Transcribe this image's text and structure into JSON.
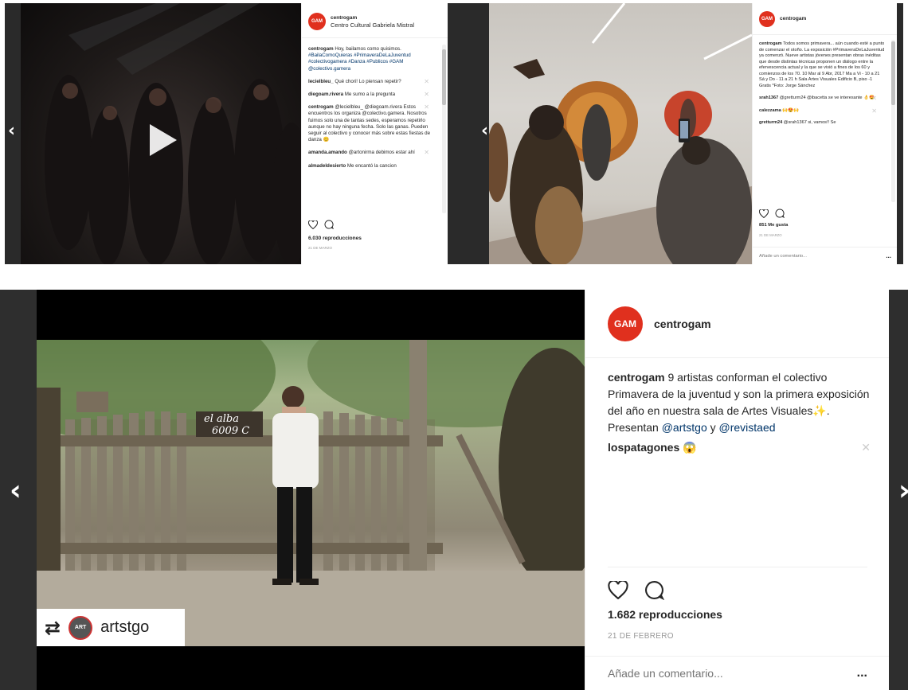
{
  "panel1": {
    "username": "centrogam",
    "location": "Centro Cultural Gabriela Mistral",
    "avatar_text": "GAM",
    "caption_user": "centrogam",
    "caption_text": "Hoy, bailamos como quisimos.",
    "caption_tags": "#BailaComoQuieras #PrimaveraDeLaJuventud #colectivogamera #Danza #Publicos #GAM @colectivo.gamera",
    "comments": [
      {
        "user": "lecielbleu_",
        "text": "Qué chori! Lo piensan repetir?"
      },
      {
        "user": "diegoam.rivera",
        "text": "Me sumo a la pregunta"
      },
      {
        "user": "centrogam",
        "text": "@lecielbleu_ @diegoam.rivera Estos encuentros los organiza @colectivo.gamera. Nosotros fuimos solo una de tantas sedes, esperamos repetirlo aunque no hay ninguna fecha. Solo las ganas. Pueden seguir al colectivo y conocer más sobre estas fiestas de danza 😊"
      },
      {
        "user": "amanda.amando",
        "text": "@artonirma debimos estar ahí"
      },
      {
        "user": "almadeldesierto",
        "text": "Me encantó la cancion"
      }
    ],
    "views": "6.030 reproducciones",
    "date": "21 DE MARZO"
  },
  "panel2": {
    "username": "centrogam",
    "avatar_text": "GAM",
    "caption_user": "centrogam",
    "caption_text": "Todos somos primavera... aún cuando esté a punto de comenzar el otoño. La exposición #PrimaveraDeLaJuventud ya comenzó. Nueve artistas jóvenes presentan obras inéditas que desde distintas técnicas proponen un diálogo entre la efervescencia actual y la que se vivió a fines de los 60 y comienzos de los 70. 10 Mar al 9 Abr, 2017 Ma a Vi - 10 a 21 Sá y Do - 11 a 21 h Sala Artes Visuales Edificio B, piso -1 Gratis *Foto: Jorge Sánchez",
    "comments": [
      {
        "user": "srah1367",
        "text": "@gretturm24 @ibacetta se ve interesante 👌😍"
      },
      {
        "user": "calezzama",
        "text": "🙌😍🙌"
      },
      {
        "user": "gretturm24",
        "text": "@srah1367 si, vamos!! Se"
      }
    ],
    "likes": "851 Me gusta",
    "date": "21 DE MARZO",
    "add_comment_placeholder": "Añade un comentario...",
    "more": "..."
  },
  "panel3": {
    "username": "centrogam",
    "avatar_text": "GAM",
    "caption_user": "centrogam",
    "caption_text": "9 artistas conforman el colectivo Primavera de la juventud y son la primera exposición del año en nuestra sala de Artes Visuales✨. Presentan",
    "mention1": "@artstgo",
    "caption_and": "y",
    "mention2": "@revistaed",
    "comment_user": "lospatagones",
    "comment_text": "😱",
    "sign_text1": "el alba",
    "sign_text2": "6009 C",
    "repost_user": "artstgo",
    "repost_avatar_text": "ART",
    "views": "1.682 reproducciones",
    "date": "21 DE FEBRERO",
    "add_comment_placeholder": "Añade un comentario...",
    "more": "..."
  },
  "nav": {
    "left": "‹",
    "right": "›"
  }
}
